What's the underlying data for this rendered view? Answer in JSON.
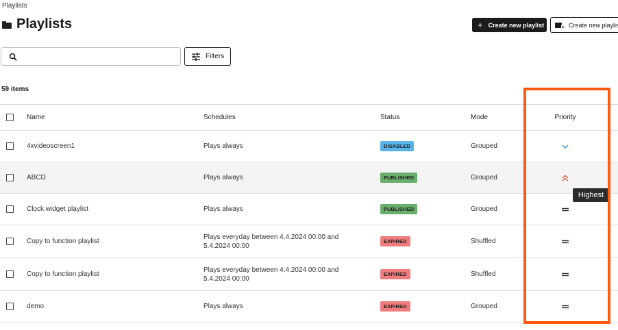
{
  "breadcrumb": "Playlists",
  "page_title": "Playlists",
  "actions": {
    "create_primary": "Create new playlist",
    "create_secondary": "Create new playlist"
  },
  "search": {
    "placeholder": ""
  },
  "filters_label": "Filters",
  "items_count": "59 items",
  "columns": {
    "name": "Name",
    "schedules": "Schedules",
    "status": "Status",
    "mode": "Mode",
    "priority": "Priority"
  },
  "rows": [
    {
      "name": "4xvideoscreen1",
      "schedule": "Plays always",
      "status": "DISABLED",
      "status_color": "#5ab4e6",
      "mode": "Grouped",
      "priority_icon": "chevron-down-icon"
    },
    {
      "name": "ABCD",
      "schedule": "Plays always",
      "status": "PUBLISHED",
      "status_color": "#6aae6d",
      "mode": "Grouped",
      "priority_icon": "double-chevron-up-icon"
    },
    {
      "name": "Clock widget playlist",
      "schedule": "Plays always",
      "status": "PUBLISHED",
      "status_color": "#6aae6d",
      "mode": "Grouped",
      "priority_icon": "equals-icon"
    },
    {
      "name": "Copy to function playlist",
      "schedule_line1": "Plays everyday between 4.4.2024 00:00 and",
      "schedule_line2": "5.4.2024 00:00",
      "status": "EXPIRED",
      "status_color": "#ef7d7d",
      "mode": "Shuffled",
      "priority_icon": "equals-icon"
    },
    {
      "name": "Copy to function playlist",
      "schedule_line1": "Plays everyday between 4.4.2024 00:00 and",
      "schedule_line2": "5.4.2024 00:00",
      "status": "EXPIRED",
      "status_color": "#ef7d7d",
      "mode": "Shuffled",
      "priority_icon": "equals-icon"
    },
    {
      "name": "demo",
      "schedule": "Plays always",
      "status": "EXPIRED",
      "status_color": "#ef7d7d",
      "mode": "Grouped",
      "priority_icon": "equals-icon"
    }
  ],
  "tooltip": "Highest",
  "colors": {
    "highlight": "#ff5a0d",
    "priority_down": "#3a8ed6",
    "priority_highest": "#e0553b"
  }
}
